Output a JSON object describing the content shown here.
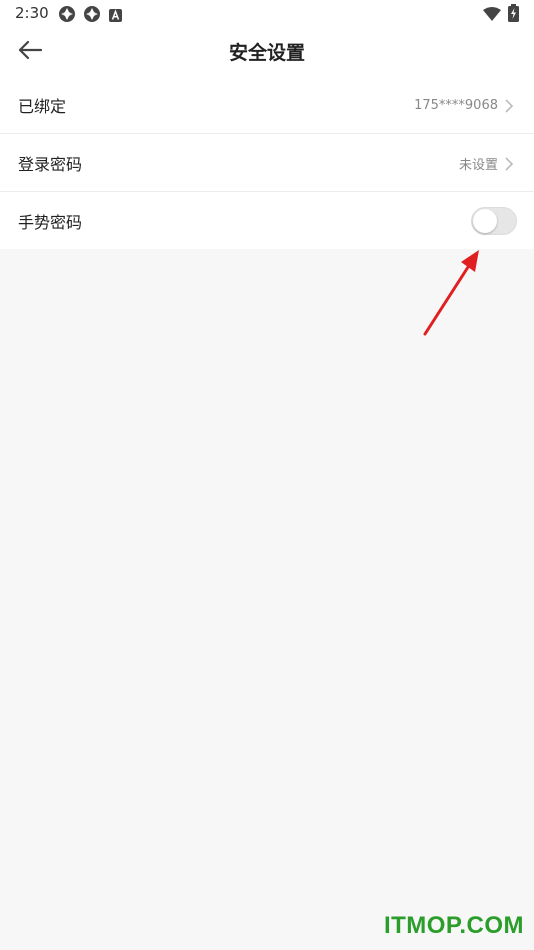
{
  "status_bar": {
    "time": "2:30",
    "icons": [
      "app-icon-1",
      "app-icon-2",
      "a-icon",
      "wifi-icon",
      "battery-charging-icon"
    ]
  },
  "header": {
    "title": "安全设置",
    "back_icon": "arrow-left-icon"
  },
  "settings": [
    {
      "label": "已绑定",
      "value": "175****9068",
      "has_chevron": true
    },
    {
      "label": "登录密码",
      "value": "未设置",
      "has_chevron": true
    },
    {
      "label": "手势密码",
      "toggle_on": false
    }
  ],
  "watermark": "ITMOP.COM",
  "colors": {
    "background": "#f7f7f7",
    "row_background": "#ffffff",
    "annotation_arrow": "#e02020",
    "watermark": "#2a9d2a"
  }
}
